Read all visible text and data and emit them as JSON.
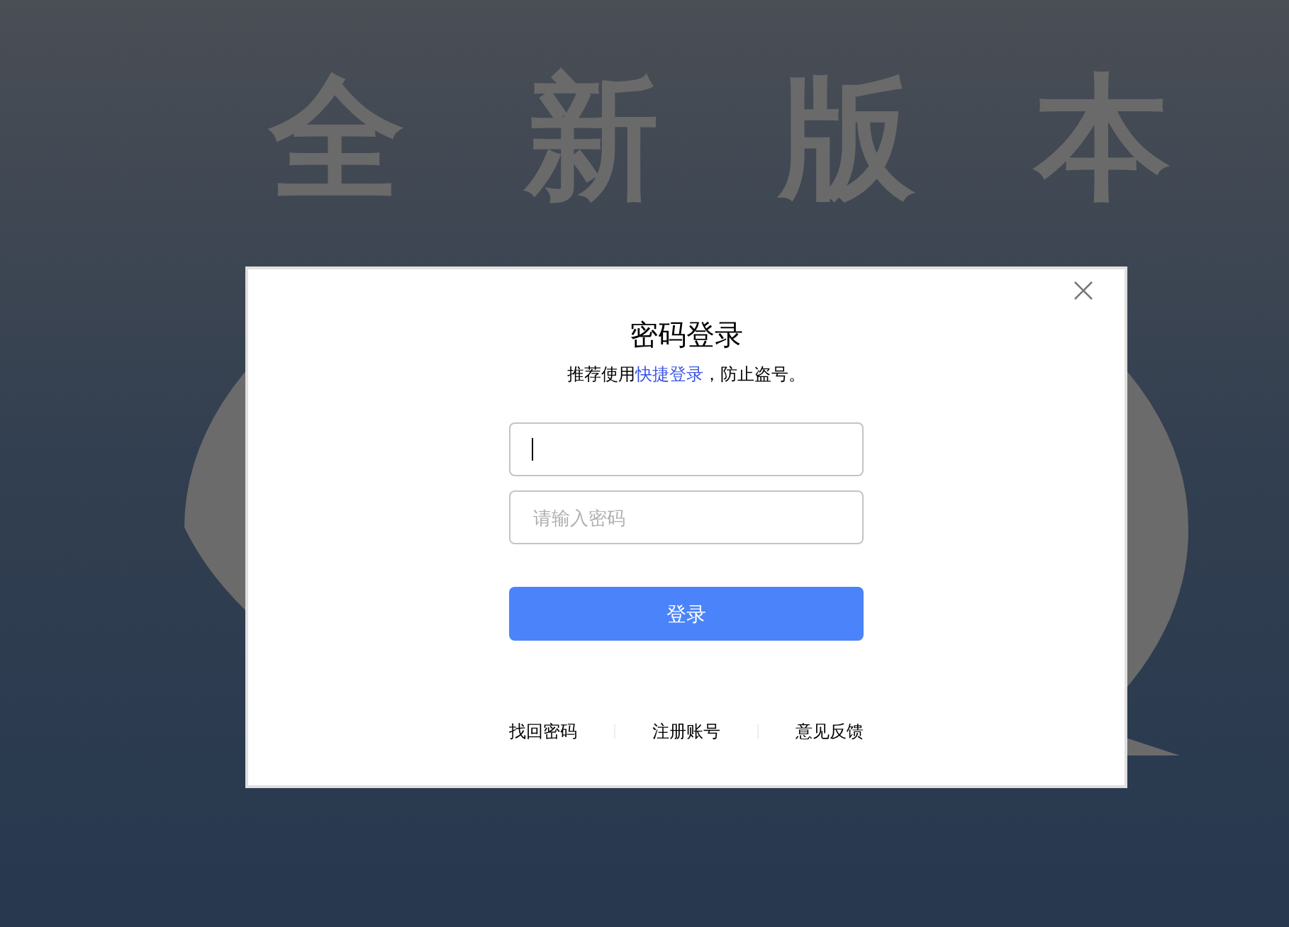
{
  "banner": [
    "全",
    "新",
    "版",
    "本"
  ],
  "dialog": {
    "title": "密码登录",
    "hint": {
      "before": "推荐使用",
      "link": "快捷登录",
      "after": "，防止盗号。"
    },
    "fields": [
      {
        "focused": true
      },
      {
        "placeholder": "请输入密码",
        "focused": false
      }
    ],
    "submit": "登录",
    "links": [
      "找回密码",
      "注册账号",
      "意见反馈"
    ]
  }
}
